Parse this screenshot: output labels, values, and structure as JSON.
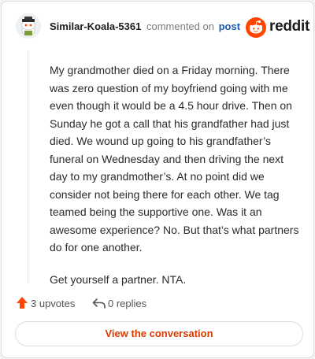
{
  "header": {
    "username": "Similar-Koala-5361",
    "action_text": "commented on",
    "post_link": "post",
    "logo_text": "reddit"
  },
  "comment": {
    "paragraphs": [
      "My grandmother died on a Friday morning. There was zero question of my boyfriend going with me even though it would be a 4.5 hour drive. Then on Sunday he got a call that his grandfather had just died. We wound up going to his grandfather’s funeral on Wednesday and then driving the next day to my grandmother’s. At no point did we consider not being there for each other. We tag teamed being the supportive one. Was it an awesome experience? No. But that’s what partners do for one another.",
      "Get yourself a partner. NTA."
    ]
  },
  "actions": {
    "upvotes": "3 upvotes",
    "replies": "0 replies"
  },
  "footer": {
    "button_label": "View the conversation"
  },
  "colors": {
    "brand": "#ff4500",
    "link": "#1a5ab8",
    "button_text": "#d93a00"
  },
  "icons": [
    "avatar-snoo-icon",
    "reddit-logo-icon",
    "upvote-arrow-icon",
    "reply-arrow-icon"
  ]
}
